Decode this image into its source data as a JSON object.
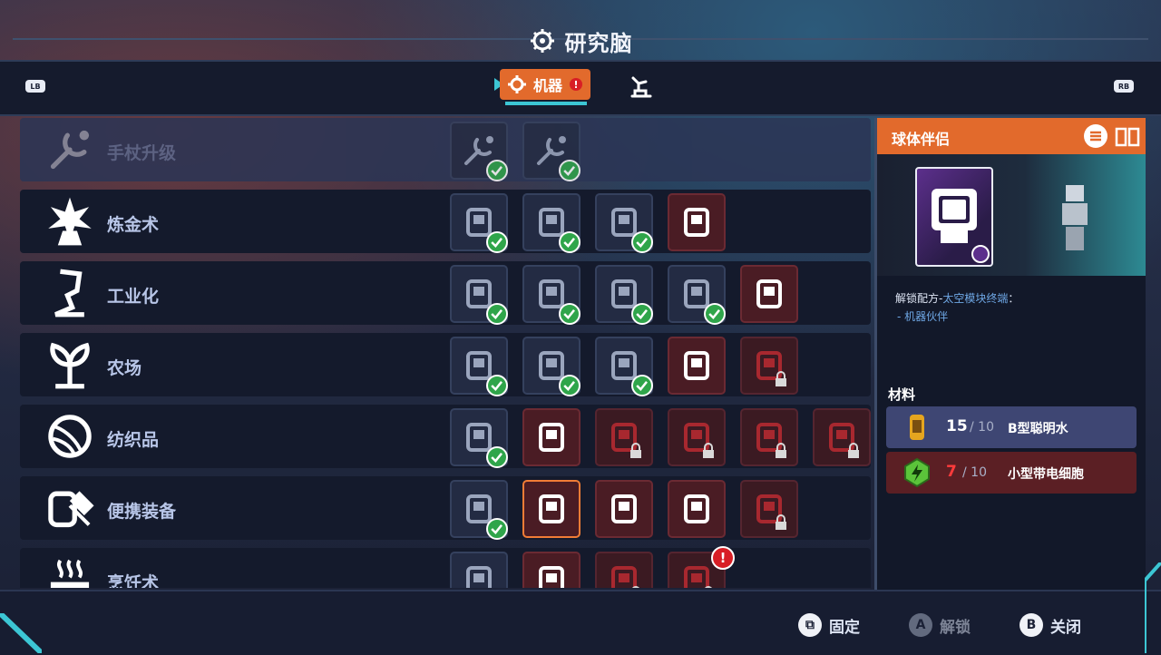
{
  "header": {
    "title": "研究脑",
    "brain_icon": "brain-icon"
  },
  "tabs": {
    "left_shoulder": "LB",
    "right_shoulder": "RB",
    "active_label": "机器",
    "active_alert": "!",
    "other_tab_icon": "arm-icon"
  },
  "rows": [
    {
      "name": "手杖升级",
      "icon": "wrench-spark-icon",
      "faded": true,
      "slots": [
        {
          "state": "done",
          "icon": "wrench-spark-icon"
        },
        {
          "state": "done",
          "icon": "wrench-spark-icon"
        }
      ]
    },
    {
      "name": "炼金术",
      "icon": "flask-burst-icon",
      "slots": [
        {
          "state": "done",
          "icon": "tank-icon"
        },
        {
          "state": "done",
          "icon": "cabinet-icon"
        },
        {
          "state": "done",
          "icon": "pot-icon"
        },
        {
          "state": "available",
          "icon": "machine-icon"
        }
      ]
    },
    {
      "name": "工业化",
      "icon": "forge-icon",
      "slots": [
        {
          "state": "done",
          "icon": "camera-icon"
        },
        {
          "state": "done",
          "icon": "lantern-icon"
        },
        {
          "state": "done",
          "icon": "yarn-icon"
        },
        {
          "state": "done",
          "icon": "dispenser-icon"
        },
        {
          "state": "available",
          "icon": "gears-icon"
        }
      ]
    },
    {
      "name": "农场",
      "icon": "sprout-icon",
      "slots": [
        {
          "state": "done",
          "icon": "robot-icon"
        },
        {
          "state": "done",
          "icon": "barrel-icon"
        },
        {
          "state": "done",
          "icon": "cooking-pot-icon"
        },
        {
          "state": "available",
          "icon": "cart-icon"
        },
        {
          "state": "locked",
          "icon": "car-icon"
        }
      ]
    },
    {
      "name": "纺织品",
      "icon": "yarn-ball-icon",
      "slots": [
        {
          "state": "done",
          "icon": "loom-icon"
        },
        {
          "state": "available",
          "icon": "yarn-cloth-icon"
        },
        {
          "state": "locked",
          "icon": "yarn-icon"
        },
        {
          "state": "locked",
          "icon": "yarn-icon"
        },
        {
          "state": "locked",
          "icon": "yarn-icon"
        },
        {
          "state": "locked",
          "icon": "yarn-icon"
        }
      ]
    },
    {
      "name": "便携装备",
      "icon": "backpack-hammer-icon",
      "slots": [
        {
          "state": "done",
          "icon": "octopus-icon"
        },
        {
          "state": "selected",
          "icon": "orb-companion-icon"
        },
        {
          "state": "available",
          "icon": "canister-icon"
        },
        {
          "state": "available",
          "icon": "rat-icon"
        },
        {
          "state": "locked",
          "icon": "drop-icon"
        }
      ]
    },
    {
      "name": "烹饪术",
      "icon": "steaming-pot-icon",
      "slots": [
        {
          "state": "done",
          "icon": "stove-icon"
        },
        {
          "state": "available",
          "icon": "fridge-icon"
        },
        {
          "state": "locked",
          "icon": "lantern-icon"
        },
        {
          "state": "locked",
          "icon": "shelf-icon",
          "alert": "!"
        }
      ]
    }
  ],
  "side": {
    "title": "球体伴侣",
    "unlock_prefix": "解锁配方-",
    "unlock_link": "太空模块终端",
    "unlock_suffix": "：",
    "unlock_item": "- 机器伙伴",
    "materials_title": "材料",
    "materials": [
      {
        "have": "15",
        "need": "/ 10",
        "name": "B型聪明水",
        "icon": "smart-water-icon",
        "enough": true
      },
      {
        "have": "7",
        "need": "/ 10",
        "name": "小型带电细胞",
        "icon": "charged-cell-icon",
        "enough": false
      }
    ]
  },
  "footer": {
    "pin": {
      "button": "⧉",
      "label": "固定"
    },
    "unlock": {
      "button": "A",
      "label": "解锁"
    },
    "close": {
      "button": "B",
      "label": "关闭"
    }
  },
  "colors": {
    "accent": "#e26a2c",
    "cyan": "#3cc6d4",
    "check": "#2fa54a",
    "alert": "#d81e25"
  }
}
